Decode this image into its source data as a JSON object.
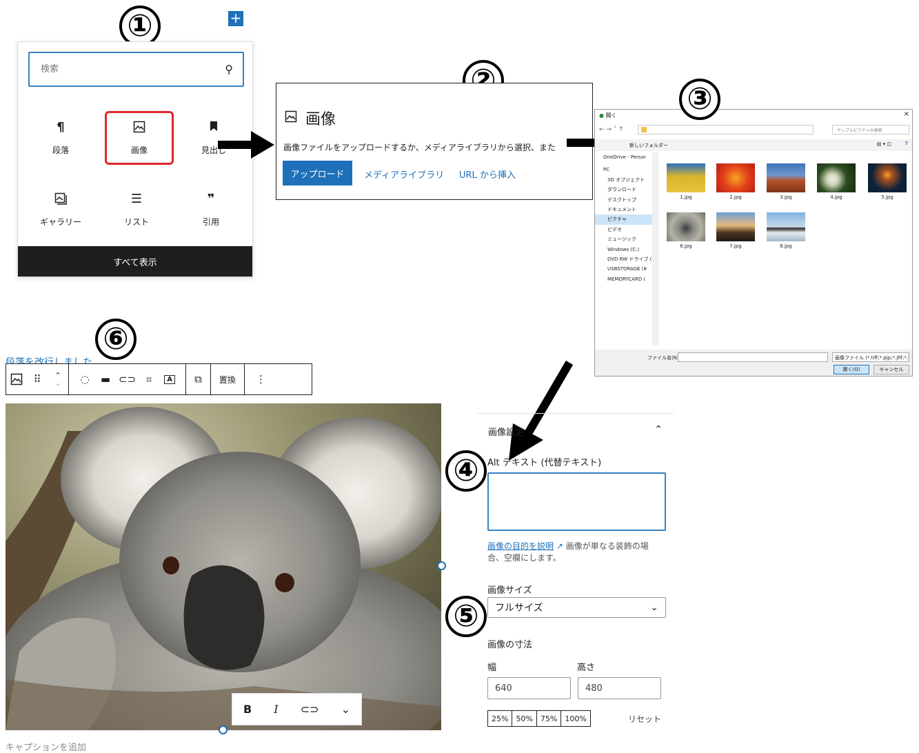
{
  "steps": [
    "①",
    "②",
    "③",
    "④",
    "⑤",
    "⑥"
  ],
  "inserter": {
    "plus": "+",
    "search_placeholder": "検索",
    "blocks": [
      {
        "label": "段落",
        "icon": "¶",
        "icon_name": "paragraph-icon"
      },
      {
        "label": "画像",
        "icon": "🖾",
        "icon_name": "image-icon"
      },
      {
        "label": "見出し",
        "icon": "■",
        "icon_name": "heading-icon"
      },
      {
        "label": "ギャラリー",
        "icon": "⧉",
        "icon_name": "gallery-icon"
      },
      {
        "label": "リスト",
        "icon": "☰",
        "icon_name": "list-icon"
      },
      {
        "label": "引用",
        "icon": "❞",
        "icon_name": "quote-icon"
      }
    ],
    "selected_block": "画像",
    "show_all": "すべて表示"
  },
  "upload": {
    "title": "画像",
    "description": "画像ファイルをアップロードするか、メディアライブラリから選択、また",
    "upload_button": "アップロード",
    "media_library": "メディアライブラリ",
    "insert_url": "URL から挿入"
  },
  "file_dialog": {
    "title": "開く",
    "search_placeholder": "サンプルピクチャの検索",
    "new_folder": "新しいフォルダー",
    "tree": [
      "OneDrive - Persor",
      "PC",
      "3D オブジェクト",
      "ダウンロード",
      "デスクトップ",
      "ドキュメント",
      "ピクチャ",
      "ビデオ",
      "ミュージック",
      "Windows (C:)",
      "DVD RW ドライブ (",
      "USBSTORAGE (¥",
      "MEMORYCARD ("
    ],
    "active_tree_item": "ピクチャ",
    "files": [
      "1.jpg",
      "2.jpg",
      "3.jpg",
      "4.jpg",
      "5.jpg",
      "6.jpg",
      "7.jpg",
      "8.jpg"
    ],
    "filename_label": "ファイル名(N):",
    "filetype": "画像ファイル (*.tiff;*.pjp;*.jfif;*.bm",
    "open_button": "開く(O)",
    "cancel_button": "キャンセル"
  },
  "editor": {
    "previous_paragraph": "段落を改行しました",
    "toolbar_replace": "置換",
    "caption_placeholder": "キャプションを追加",
    "format_bold": "B",
    "format_italic": "I"
  },
  "settings": {
    "section_title": "画像設定",
    "alt_label": "Alt テキスト (代替テキスト)",
    "alt_value": "",
    "help_link": "画像の目的を説明",
    "help_text": "画像が単なる装飾の場合、空欄にします。",
    "size_label": "画像サイズ",
    "size_value": "フルサイズ",
    "dimensions_label": "画像の寸法",
    "width_label": "幅",
    "height_label": "高さ",
    "width": "640",
    "height": "480",
    "percent_options": [
      "25%",
      "50%",
      "75%",
      "100%"
    ],
    "reset": "リセット"
  },
  "colors": {
    "accent": "#1e70b8",
    "highlight": "#e0262b",
    "dark": "#1e1e1e"
  }
}
